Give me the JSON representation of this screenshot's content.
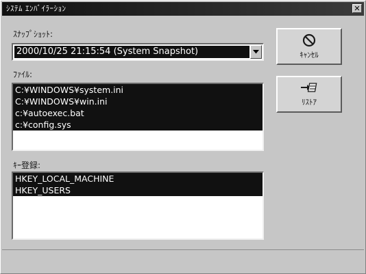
{
  "window": {
    "title": "ｼｽﾃﾑ ｴﾝﾊﾞｲﾗｰｼｮﾝ",
    "close_glyph": "✕"
  },
  "snapshot": {
    "label": "ｽﾅｯﾌﾟｼｮｯﾄ:",
    "selected": "2000/10/25 21:15:54 (System Snapshot)",
    "arrow_icon": "dropdown-arrow-icon"
  },
  "files": {
    "label": "ﾌｧｲﾙ:",
    "items": [
      "C:¥WINDOWS¥system.ini",
      "C:¥WINDOWS¥win.ini",
      "c:¥autoexec.bat",
      "c:¥config.sys"
    ]
  },
  "registry": {
    "label": "ｷｰ登録:",
    "items": [
      "HKEY_LOCAL_MACHINE",
      "HKEY_USERS"
    ]
  },
  "buttons": {
    "cancel_label": "ｷｬﾝｾﾙ",
    "cancel_icon": "prohibited-icon",
    "restore_label": "ﾘｽﾄｱ",
    "restore_icon": "restore-arrow-icon"
  },
  "colors": {
    "selection": "#111111",
    "face": "#c6c6c6"
  }
}
